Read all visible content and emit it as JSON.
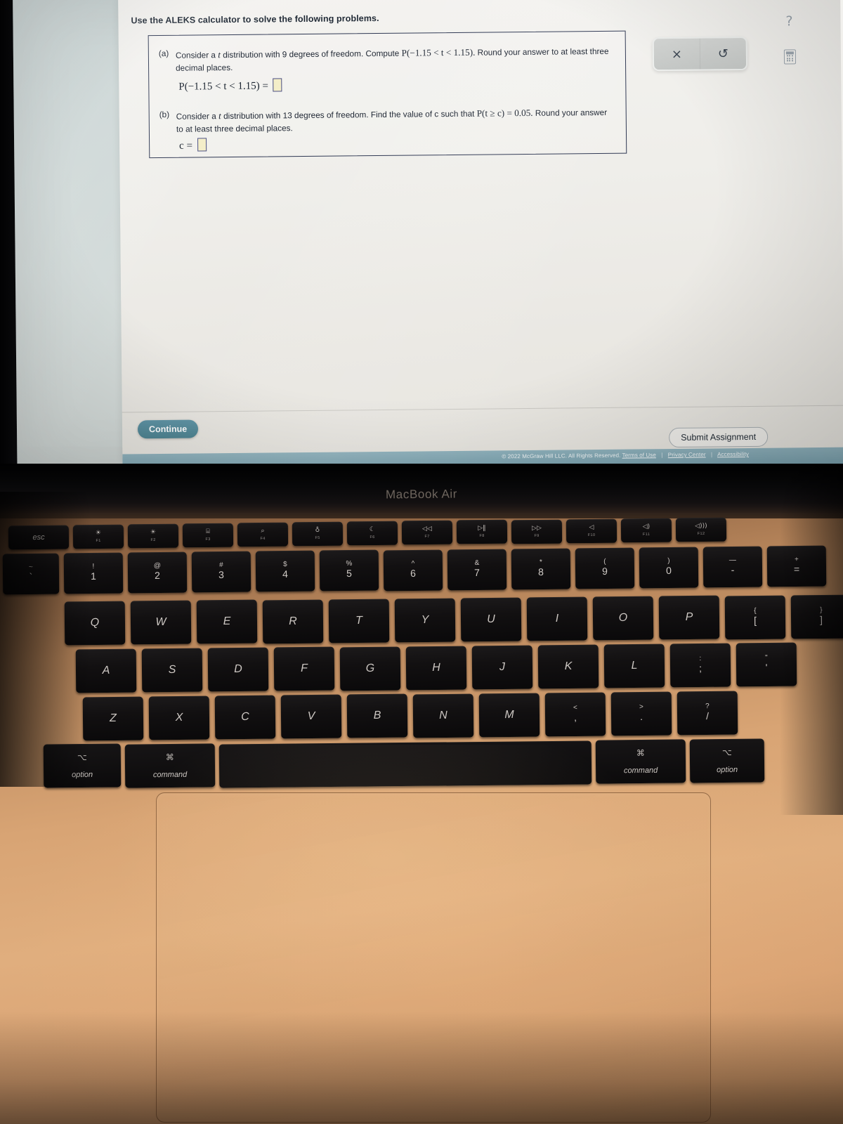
{
  "device": {
    "bezel_label": "MacBook Air"
  },
  "page": {
    "prompt": "Use the ALEKS calculator to solve the following problems.",
    "question_a": {
      "label": "(a)",
      "text_before": "Consider a",
      "t_italic": "t",
      "text_mid": "distribution with 9 degrees of freedom. Compute",
      "expr_inline": "P(−1.15 < t < 1.15).",
      "text_after": "Round your answer to at least three decimal places.",
      "equation": "P(−1.15 < t < 1.15) =",
      "answer_value": ""
    },
    "question_b": {
      "label": "(b)",
      "text_before": "Consider a",
      "t_italic": "t",
      "text_mid": "distribution with 13 degrees of freedom. Find the value of c such that",
      "expr_inline": "P(t ≥ c) = 0.05.",
      "text_after": "Round your answer to at least three decimal places.",
      "equation": "c =",
      "answer_value": ""
    },
    "toolbar": {
      "clear_icon": "×",
      "undo_icon": "↺"
    },
    "side_icons": {
      "help": "?",
      "calculator": "calculator-icon"
    },
    "buttons": {
      "continue": "Continue",
      "submit": "Submit Assignment"
    },
    "footer": {
      "copyright": "© 2022 McGraw Hill LLC. All Rights Reserved.",
      "links": [
        "Terms of Use",
        "Privacy Center",
        "Accessibility"
      ],
      "separator": "|"
    },
    "colors": {
      "teal": "#7aa1ae",
      "continue_button": "#4b818f",
      "answer_box_fill": "#f4eec8",
      "answer_box_border": "#4a4f86",
      "box_border": "#2c3550"
    }
  },
  "keyboard": {
    "function_row": [
      {
        "name": "esc",
        "word": "esc",
        "glyph": "",
        "fl": ""
      },
      {
        "name": "f1",
        "word": "",
        "glyph": "☀",
        "fl": "F1"
      },
      {
        "name": "f2",
        "word": "",
        "glyph": "☀",
        "fl": "F2"
      },
      {
        "name": "f3",
        "word": "",
        "glyph": "⌸",
        "fl": "F3"
      },
      {
        "name": "f4",
        "word": "",
        "glyph": "⌕",
        "fl": "F4"
      },
      {
        "name": "f5",
        "word": "",
        "glyph": "♁",
        "fl": "F5"
      },
      {
        "name": "f6",
        "word": "",
        "glyph": "☾",
        "fl": "F6"
      },
      {
        "name": "f7",
        "word": "",
        "glyph": "◁◁",
        "fl": "F7"
      },
      {
        "name": "f8",
        "word": "",
        "glyph": "▷‖",
        "fl": "F8"
      },
      {
        "name": "f9",
        "word": "",
        "glyph": "▷▷",
        "fl": "F9"
      },
      {
        "name": "f10",
        "word": "",
        "glyph": "◁",
        "fl": "F10"
      },
      {
        "name": "f11",
        "word": "",
        "glyph": "◁)",
        "fl": "F11"
      },
      {
        "name": "f12",
        "word": "",
        "glyph": "◁)))",
        "fl": "F12"
      }
    ],
    "number_row": [
      {
        "name": "tilde",
        "top": "~",
        "bot": "`"
      },
      {
        "name": "one",
        "top": "!",
        "bot": "1"
      },
      {
        "name": "two",
        "top": "@",
        "bot": "2"
      },
      {
        "name": "three",
        "top": "#",
        "bot": "3"
      },
      {
        "name": "four",
        "top": "$",
        "bot": "4"
      },
      {
        "name": "five",
        "top": "%",
        "bot": "5"
      },
      {
        "name": "six",
        "top": "^",
        "bot": "6"
      },
      {
        "name": "seven",
        "top": "&",
        "bot": "7"
      },
      {
        "name": "eight",
        "top": "*",
        "bot": "8"
      },
      {
        "name": "nine",
        "top": "(",
        "bot": "9"
      },
      {
        "name": "zero",
        "top": ")",
        "bot": "0"
      },
      {
        "name": "minus",
        "top": "—",
        "bot": "-"
      },
      {
        "name": "equals",
        "top": "+",
        "bot": "="
      }
    ],
    "top_row": [
      {
        "name": "q",
        "label": "Q"
      },
      {
        "name": "w",
        "label": "W"
      },
      {
        "name": "e",
        "label": "E"
      },
      {
        "name": "r",
        "label": "R"
      },
      {
        "name": "t",
        "label": "T"
      },
      {
        "name": "y",
        "label": "Y"
      },
      {
        "name": "u",
        "label": "U"
      },
      {
        "name": "i",
        "label": "I"
      },
      {
        "name": "o",
        "label": "O"
      },
      {
        "name": "p",
        "label": "P"
      },
      {
        "name": "bracket-left",
        "top": "{",
        "bot": "["
      },
      {
        "name": "bracket-right",
        "top": "}",
        "bot": "]"
      }
    ],
    "home_row": [
      {
        "name": "a",
        "label": "A"
      },
      {
        "name": "s",
        "label": "S"
      },
      {
        "name": "d",
        "label": "D"
      },
      {
        "name": "f",
        "label": "F"
      },
      {
        "name": "g",
        "label": "G"
      },
      {
        "name": "h",
        "label": "H"
      },
      {
        "name": "j",
        "label": "J"
      },
      {
        "name": "k",
        "label": "K"
      },
      {
        "name": "l",
        "label": "L"
      },
      {
        "name": "semicolon",
        "top": ":",
        "bot": ";"
      },
      {
        "name": "quote",
        "top": "\"",
        "bot": "'"
      }
    ],
    "bottom_row": [
      {
        "name": "z",
        "label": "Z"
      },
      {
        "name": "x",
        "label": "X"
      },
      {
        "name": "c",
        "label": "C"
      },
      {
        "name": "v",
        "label": "V"
      },
      {
        "name": "b",
        "label": "B"
      },
      {
        "name": "n",
        "label": "N"
      },
      {
        "name": "m",
        "label": "M"
      },
      {
        "name": "comma",
        "top": "<",
        "bot": ","
      },
      {
        "name": "period",
        "top": ">",
        "bot": "."
      },
      {
        "name": "slash",
        "top": "?",
        "bot": "/"
      }
    ],
    "modifier_row": {
      "option_left_symbol": "⌥",
      "option_left_word": "option",
      "command_left_symbol": "⌘",
      "command_left_word": "command",
      "command_right_symbol": "⌘",
      "command_right_word": "command",
      "option_right_symbol": "⌥",
      "option_right_word": "option"
    }
  }
}
